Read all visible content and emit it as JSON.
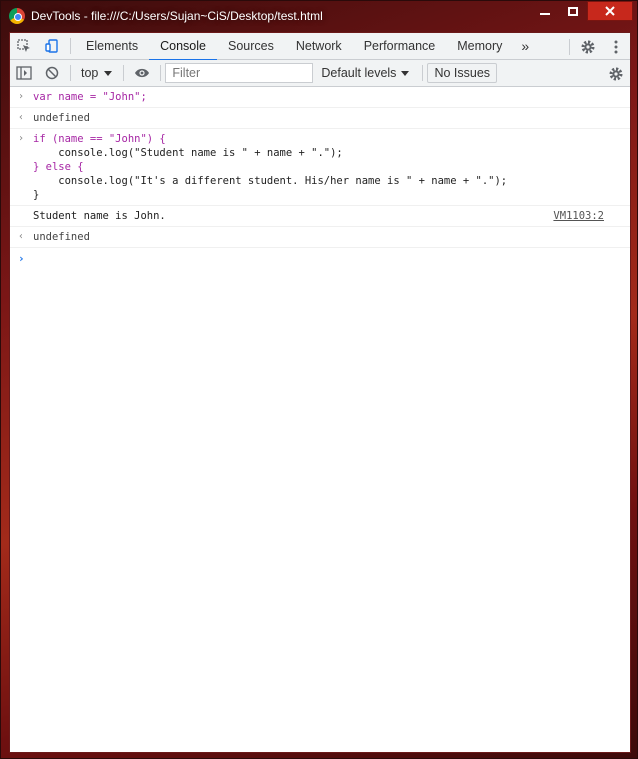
{
  "window": {
    "title": "DevTools - file:///C:/Users/Sujan~CiS/Desktop/test.html"
  },
  "tabs": [
    {
      "label": "Elements"
    },
    {
      "label": "Console"
    },
    {
      "label": "Sources"
    },
    {
      "label": "Network"
    },
    {
      "label": "Performance"
    },
    {
      "label": "Memory"
    }
  ],
  "more_tabs": "»",
  "toolbar": {
    "context": "top",
    "filter_placeholder": "Filter",
    "levels": "Default levels",
    "issues": "No Issues"
  },
  "console": {
    "entries": [
      {
        "code": "var name = \"John\";"
      },
      {
        "result": "undefined"
      },
      {
        "code_lines": [
          "if (name == \"John\") {",
          "    console.log(\"Student name is \" + name + \".\");",
          "} else {",
          "    console.log(\"It's a different student. His/her name is \" + name + \".\");",
          "}"
        ]
      },
      {
        "log": "Student name is John.",
        "source": "VM1103:2"
      },
      {
        "result": "undefined"
      }
    ]
  },
  "colors": {
    "accent": "#1a73e8",
    "keyword": "#a626a4",
    "string": "#c41a16",
    "variable": "#1c00cf"
  }
}
